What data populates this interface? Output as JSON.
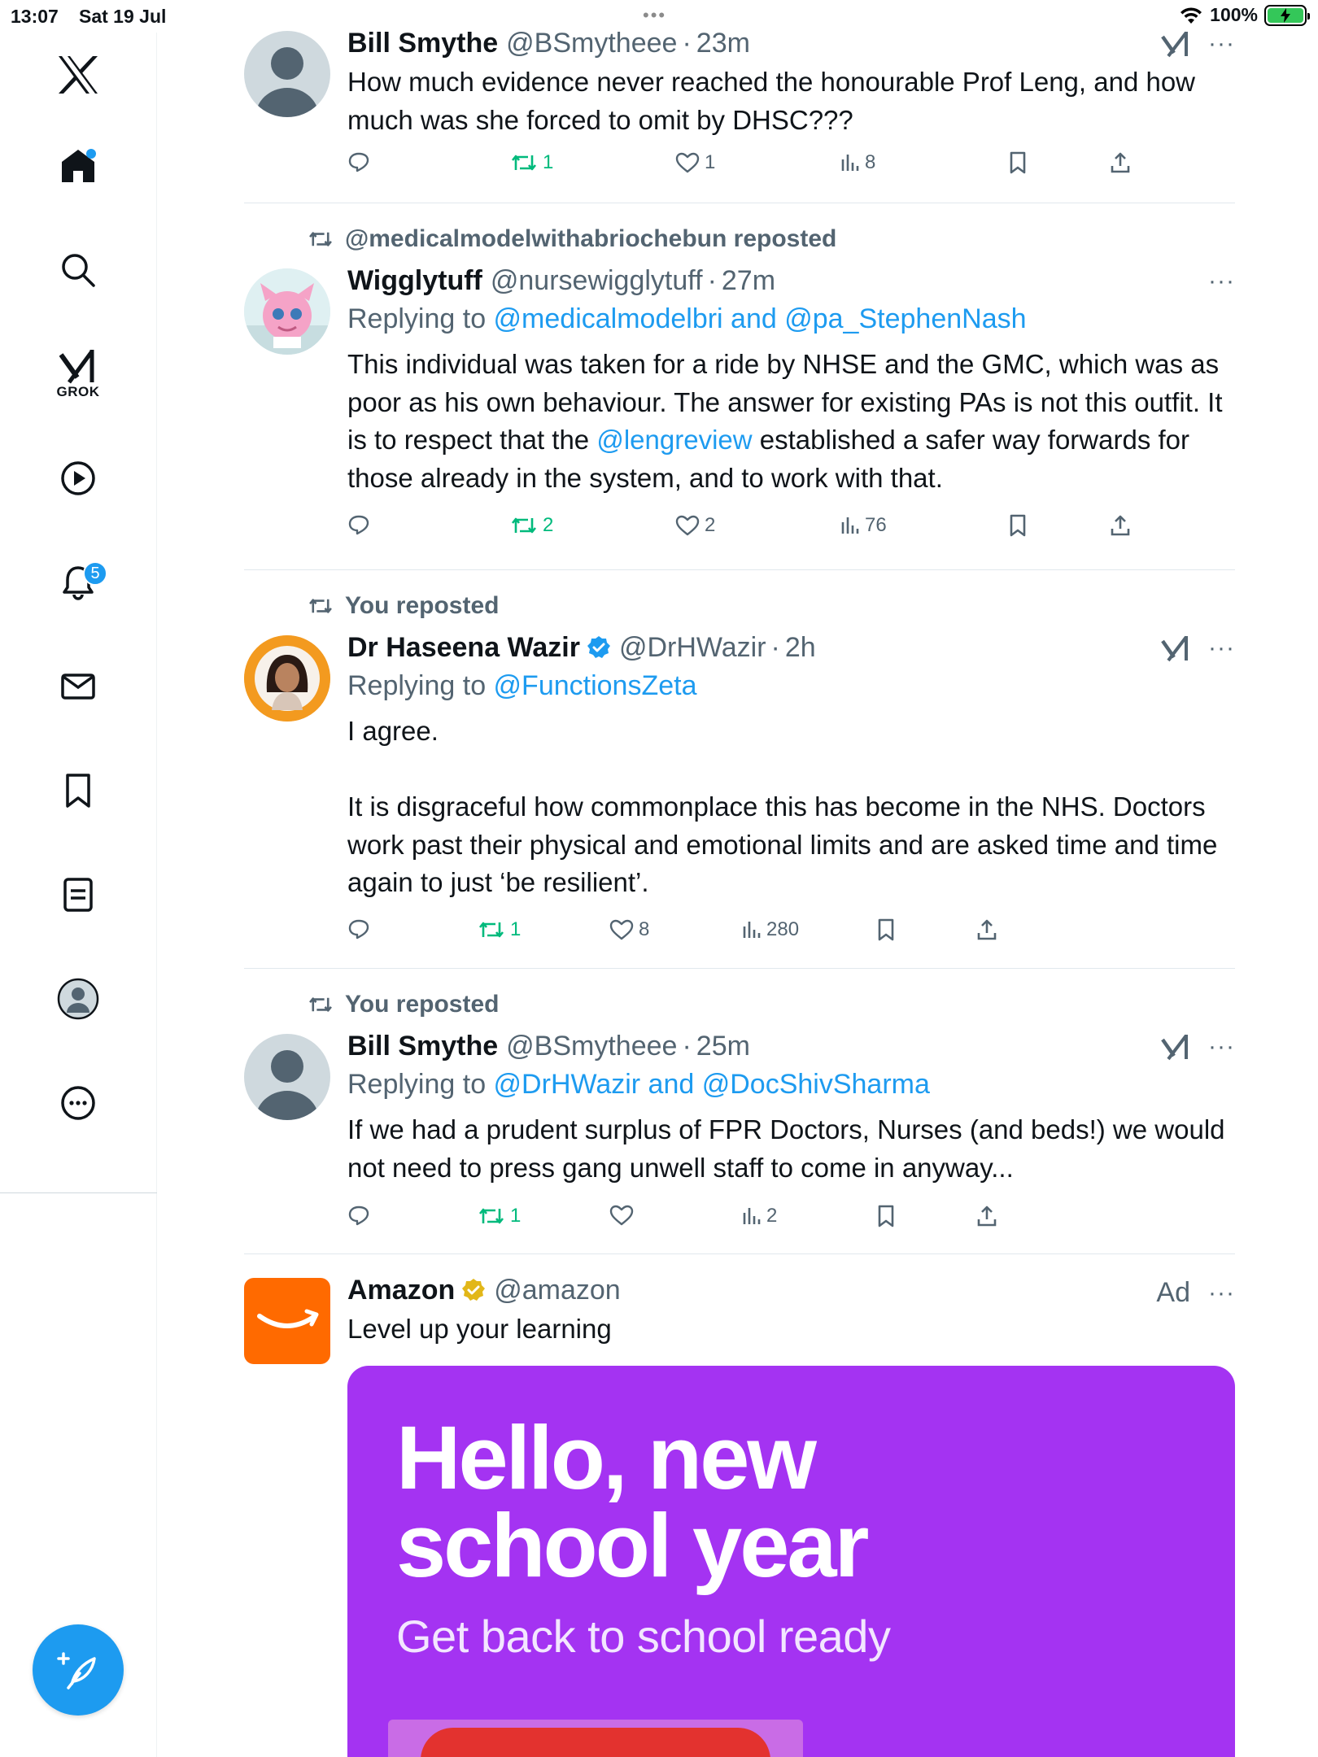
{
  "status_bar": {
    "time": "13:07",
    "date": "Sat 19 Jul",
    "battery": "100%",
    "multitask": "•••"
  },
  "sidebar": {
    "grok_label": "GROK",
    "notifications_count": "5",
    "items": [
      "home",
      "search",
      "grok",
      "video",
      "notifications",
      "messages",
      "bookmarks",
      "lists",
      "profile",
      "more"
    ]
  },
  "colors": {
    "accent": "#1d9bf0",
    "repost_green": "#00ba7c",
    "muted": "#536471",
    "ad_bg": "#a433f2",
    "amazon": "#ff6a00"
  },
  "posts": [
    {
      "name": "Bill Smythe",
      "handle": "@BSmytheee",
      "sep": "·",
      "time": "23m",
      "text": "How much evidence never reached the honourable Prof Leng, and how much was she forced to omit by DHSC???",
      "reposts": "1",
      "likes": "1",
      "views": "8"
    },
    {
      "repost_label": "@medicalmodelwithabriochebun reposted",
      "name": "Wigglytuff",
      "handle": "@nursewigglytuff",
      "sep": "·",
      "time": "27m",
      "replying_prefix": "Replying to ",
      "replying_to": "@medicalmodelbri and @pa_StephenNash",
      "text_a": "This individual was taken for a ride by NHSE and the GMC, which was as poor as his own behaviour. The answer for existing PAs is not this outfit. It is to respect that the ",
      "text_link": "@lengreview",
      "text_b": " established a safer way forwards for those already in the system, and to work with that.",
      "reposts": "2",
      "likes": "2",
      "views": "76"
    },
    {
      "repost_label": "You reposted",
      "name": "Dr Haseena Wazir",
      "handle": "@DrHWazir",
      "sep": "·",
      "time": "2h",
      "replying_prefix": "Replying to ",
      "replying_to": "@FunctionsZeta",
      "text": "I agree.\n\nIt is disgraceful how commonplace this has become in the NHS. Doctors work past their physical and emotional limits and are asked time and time again to just ‘be resilient’.",
      "reposts": "1",
      "likes": "8",
      "views": "280"
    },
    {
      "repost_label": "You reposted",
      "name": "Bill Smythe",
      "handle": "@BSmytheee",
      "sep": "·",
      "time": "25m",
      "replying_prefix": "Replying to ",
      "replying_to": "@DrHWazir and @DocShivSharma",
      "text": "If we had a prudent surplus of FPR Doctors, Nurses (and beds!) we would not need to press gang unwell staff to come in anyway...",
      "reposts": "1",
      "likes": "",
      "views": "2"
    }
  ],
  "ad": {
    "name": "Amazon",
    "handle": "@amazon",
    "ad_label": "Ad",
    "text": "Level up your learning",
    "headline_1": "Hello, new",
    "headline_2": "school year",
    "subline": "Get back to school ready"
  },
  "more_label": "···"
}
